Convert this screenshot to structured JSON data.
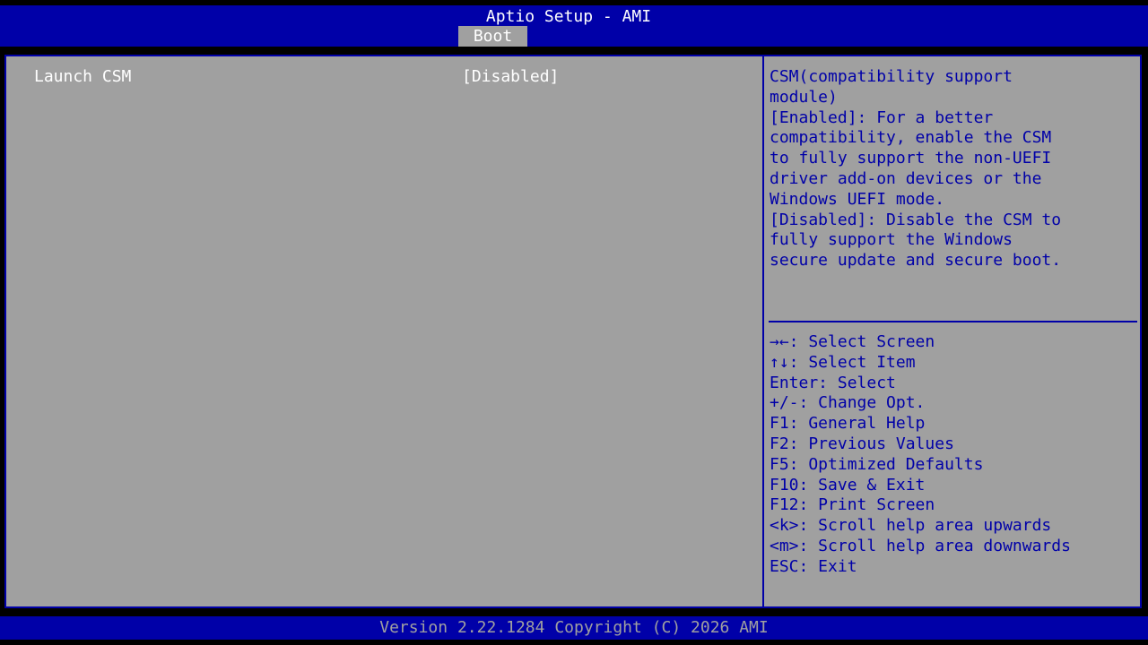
{
  "header": {
    "title": "Aptio Setup - AMI",
    "active_tab": "Boot"
  },
  "options": [
    {
      "label": "Launch CSM",
      "value": "[Disabled]"
    }
  ],
  "help": {
    "lines": [
      "CSM(compatibility support",
      "module)",
      "[Enabled]: For a better",
      "compatibility, enable the CSM",
      "to fully support the non-UEFI",
      "driver add-on devices or the",
      "Windows UEFI mode.",
      "[Disabled]: Disable the CSM to",
      "fully support the Windows",
      "secure update and secure boot."
    ]
  },
  "keys": [
    "→←: Select Screen",
    "↑↓: Select Item",
    "Enter: Select",
    "+/-: Change Opt.",
    "F1: General Help",
    "F2: Previous Values",
    "F5: Optimized Defaults",
    "F10: Save & Exit",
    "F12: Print Screen",
    "<k>: Scroll help area upwards",
    "<m>: Scroll help area downwards",
    "ESC: Exit"
  ],
  "footer": {
    "text": "Version 2.22.1284 Copyright (C) 2026 AMI"
  },
  "colors": {
    "bios_blue": "#0000a8",
    "panel_gray": "#a0a0a0",
    "text_white": "#ffffff"
  }
}
